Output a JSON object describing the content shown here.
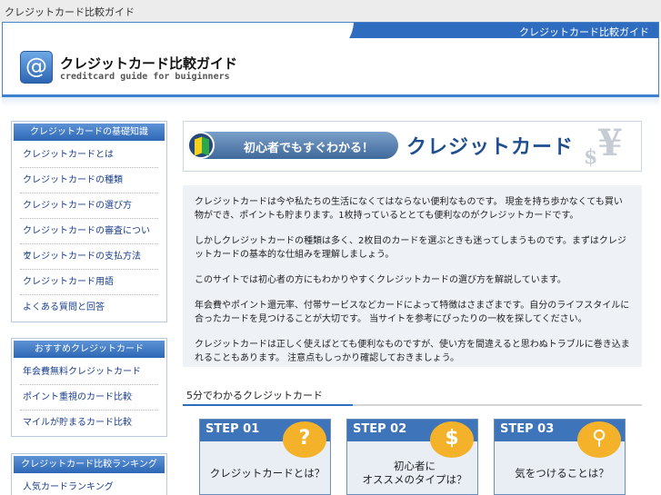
{
  "topbar": {
    "text": "クレジットカード比較ガイド"
  },
  "header": {
    "link": "クレジットカード比較ガイド",
    "logo_glyph": "@",
    "title": "クレジットカード比較ガイド",
    "subtitle": "creditcard guide for buiginners"
  },
  "sidebar": {
    "box1": {
      "title": "クレジットカードの基礎知識",
      "items": [
        "クレジットカードとは",
        "クレジットカードの種類",
        "クレジットカードの選び方",
        "クレジットカードの審査について",
        "クレジットカードの支払方法",
        "クレジットカード用語",
        "よくある質問と回答"
      ]
    },
    "box2": {
      "title": "おすすめクレジットカード",
      "items": [
        "年会費無料クレジットカード",
        "ポイント重視のカード比較",
        "マイルが貯まるカード比較"
      ]
    },
    "box3": {
      "title": "クレジットカード比較ランキング",
      "items": [
        "人気カードランキング"
      ]
    }
  },
  "banner": {
    "tag": "初心者でもすぐわかる！",
    "main": "クレジットカード",
    "yen": "¥",
    "dollar": "$"
  },
  "intro": {
    "paragraphs": [
      "クレジットカードは今や私たちの生活になくてはならない便利なものです。 現金を持ち歩かなくても買い物ができ、ポイントも貯まります。1枚持っているととても便利なのがクレジットカードです。",
      "しかしクレジットカードの種類は多く、2枚目のカードを選ぶときも迷ってしまうものです。まずはクレジットカードの基本的な仕組みを理解しましょう。",
      "このサイトでは初心者の方にもわかりやすくクレジットカードの選び方を解説しています。",
      "年会費やポイント還元率、付帯サービスなどカードによって特徴はさまざまです。自分のライフスタイルに合ったカードを見つけることが大切です。 当サイトを参考にぴったりの一枚を探してください。",
      "クレジットカードは正しく使えばとても便利なものですが、使い方を間違えると思わぬトラブルに巻き込まれることもあります。 注意点もしっかり確認しておきましょう。"
    ]
  },
  "section": {
    "title": "5分でわかるクレジットカード"
  },
  "steps": [
    {
      "label": "STEP 01",
      "badge": "?",
      "text": "クレジットカードとは？"
    },
    {
      "label": "STEP 02",
      "badge": "$",
      "text": "初心者に\nオススメのタイプは？"
    },
    {
      "label": "STEP 03",
      "badge": "⚲",
      "text": "気をつけることは？"
    }
  ]
}
